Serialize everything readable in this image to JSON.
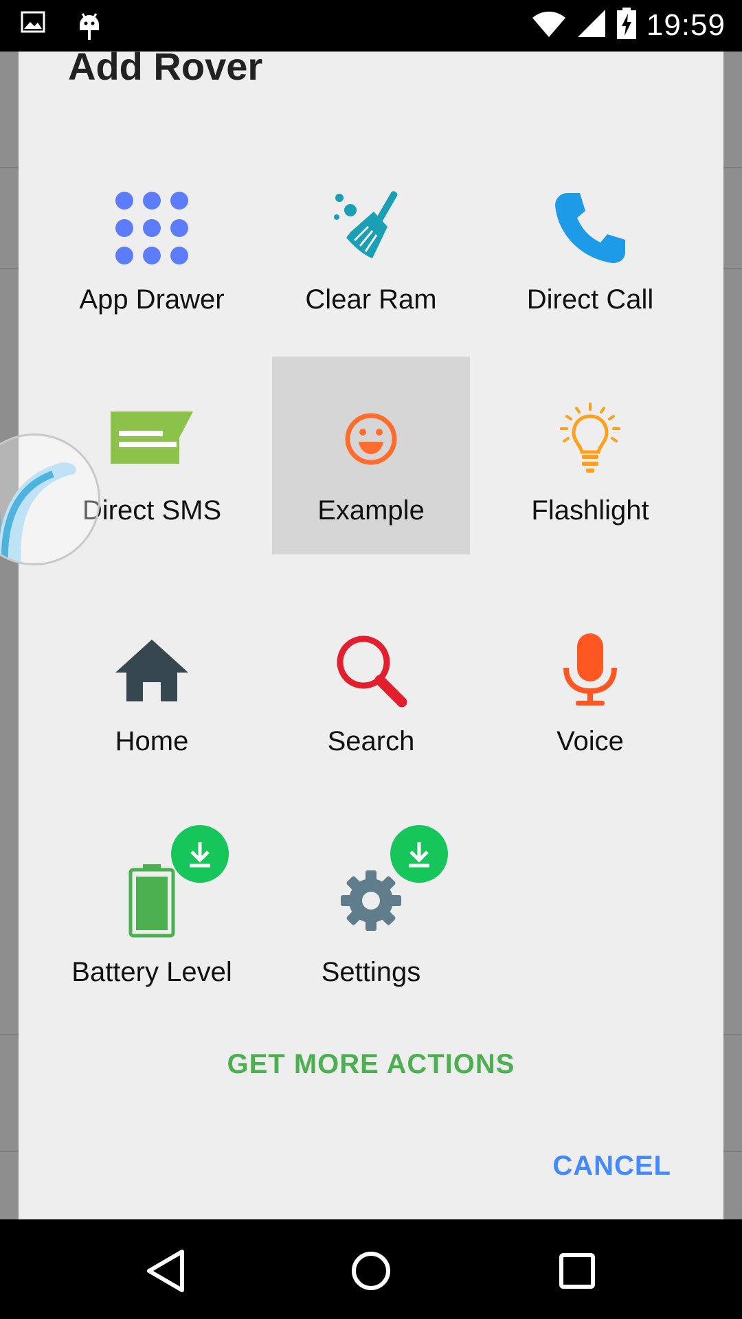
{
  "status_bar": {
    "time": "19:59",
    "icons": [
      "image-notification-icon",
      "android-debug-icon",
      "wifi-icon",
      "signal-icon",
      "battery-charging-icon"
    ]
  },
  "dialog": {
    "title": "Add Rover",
    "actions": [
      {
        "label": "App Drawer",
        "icon": "app-drawer-grid-icon",
        "color": "#5c7cfa"
      },
      {
        "label": "Clear Ram",
        "icon": "broom-icon",
        "color": "#1a9fb5"
      },
      {
        "label": "Direct Call",
        "icon": "phone-icon",
        "color": "#1e9be8"
      },
      {
        "label": "Direct SMS",
        "icon": "sms-icon",
        "color": "#8bc34a"
      },
      {
        "label": "Example",
        "icon": "smiley-icon",
        "color": "#ff6d2e",
        "selected": true
      },
      {
        "label": "Flashlight",
        "icon": "lightbulb-icon",
        "color": "#ff9f1a"
      },
      {
        "label": "Home",
        "icon": "home-icon",
        "color": "#37474f"
      },
      {
        "label": "Search",
        "icon": "search-icon",
        "color": "#e31e2d"
      },
      {
        "label": "Voice",
        "icon": "microphone-icon",
        "color": "#ff5722"
      },
      {
        "label": "Battery Level",
        "icon": "battery-icon",
        "color": "#4caf50",
        "download_badge": true
      },
      {
        "label": "Settings",
        "icon": "gear-icon",
        "color": "#607d8b",
        "download_badge": true
      }
    ],
    "get_more_label": "GET MORE ACTIONS",
    "cancel_label": "CANCEL"
  },
  "nav_bar": {
    "buttons": [
      "back-icon",
      "home-circle-icon",
      "recents-icon"
    ]
  }
}
